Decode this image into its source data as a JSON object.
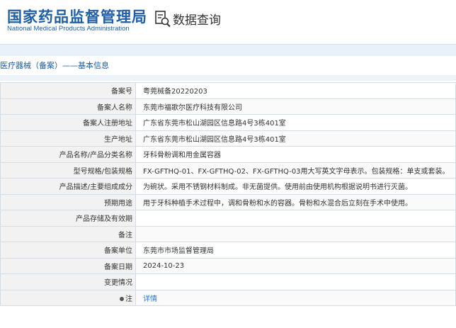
{
  "header": {
    "logo_cn": "国家药品监督管理局",
    "logo_en": "National Medical Products Administration",
    "title": "数据查询",
    "icon": "search-document-icon"
  },
  "breadcrumb": "医疗器械（备案）——基本信息",
  "rows": [
    {
      "label": "备案号",
      "value": "粤莞械备20220203"
    },
    {
      "label": "备案人名称",
      "value": "东莞市福歌尔医疗科技有限公司"
    },
    {
      "label": "备案人注册地址",
      "value": "广东省东莞市松山湖园区信息路4号3栋401室"
    },
    {
      "label": "生产地址",
      "value": "广东省东莞市松山湖园区信息路4号3栋401室"
    },
    {
      "label": "产品名称/产品分类名称",
      "value": "牙科骨粉调和用金属容器"
    },
    {
      "label": "型号规格/包装规格",
      "value": "FX-GFTHQ-01、FX-GFTHQ-02、FX-GFTHQ-03用大写英文字母表示。包装规格：单支或套装。"
    },
    {
      "label": "产品描述/主要组成成分",
      "value": "为碗状。采用不锈钢材料制成。非无菌提供。使用前由使用机构根据说明书进行灭菌。"
    },
    {
      "label": "预期用途",
      "value": "用于牙科种植手术过程中，调和骨粉和水的容器。骨粉和水混合后立刻在手术中使用。"
    },
    {
      "label": "产品存储及有效期",
      "value": ""
    },
    {
      "label": "备注",
      "value": ""
    },
    {
      "label": "备案单位",
      "value": "东莞市市场监督管理局"
    },
    {
      "label": "备案日期",
      "value": "2024-10-23"
    },
    {
      "label": "变更情况",
      "value": ""
    }
  ],
  "note": {
    "label": "注",
    "link": "详情"
  },
  "colors": {
    "brand": "#1f5fa8",
    "link": "#2b78d1",
    "label_bg": "#f2f2f2",
    "border": "#d4dde6"
  }
}
